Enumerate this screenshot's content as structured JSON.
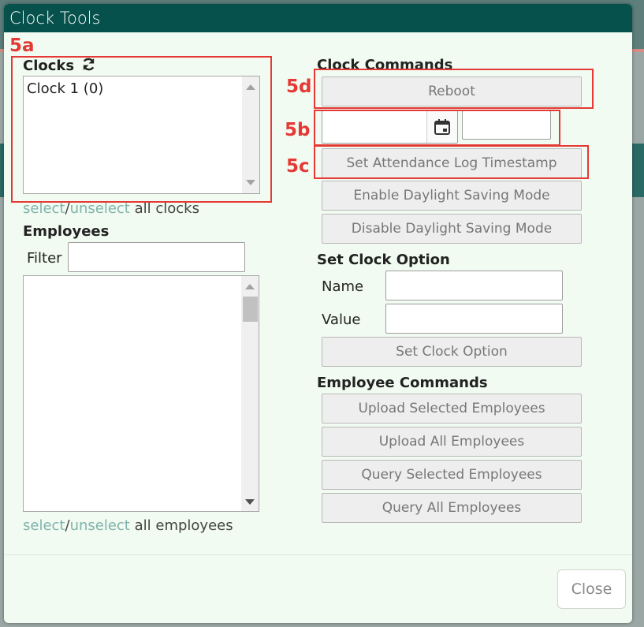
{
  "dialog": {
    "title": "Clock Tools"
  },
  "clocks": {
    "heading": "Clocks",
    "items": [
      "Clock 1 (0)"
    ],
    "select_link": "select",
    "slash": "/",
    "unselect_link": "unselect",
    "suffix": "all clocks"
  },
  "employees": {
    "heading": "Employees",
    "filter_label": "Filter",
    "filter_value": "",
    "select_link": "select",
    "slash": "/",
    "unselect_link": "unselect",
    "suffix": "all employees"
  },
  "clock_commands": {
    "heading": "Clock Commands",
    "reboot": "Reboot",
    "date_value": "",
    "time_value": "",
    "set_attendance": "Set Attendance Log Timestamp",
    "enable_dst": "Enable Daylight Saving Mode",
    "disable_dst": "Disable Daylight Saving Mode"
  },
  "clock_option": {
    "heading": "Set Clock Option",
    "name_label": "Name",
    "value_label": "Value",
    "name_value": "",
    "value_value": "",
    "button": "Set Clock Option"
  },
  "employee_commands": {
    "heading": "Employee Commands",
    "upload_selected": "Upload Selected Employees",
    "upload_all": "Upload All Employees",
    "query_selected": "Query Selected Employees",
    "query_all": "Query All Employees"
  },
  "footer": {
    "close": "Close"
  },
  "annotations": {
    "a": "5a",
    "b": "5b",
    "c": "5c",
    "d": "5d"
  },
  "colors": {
    "titlebar": "#06514c",
    "dialog_bg": "#f1fbf1",
    "link": "#7fb3ac",
    "annotation": "#e53935"
  },
  "icons": {
    "refresh": "refresh-icon",
    "calendar": "calendar-icon"
  }
}
